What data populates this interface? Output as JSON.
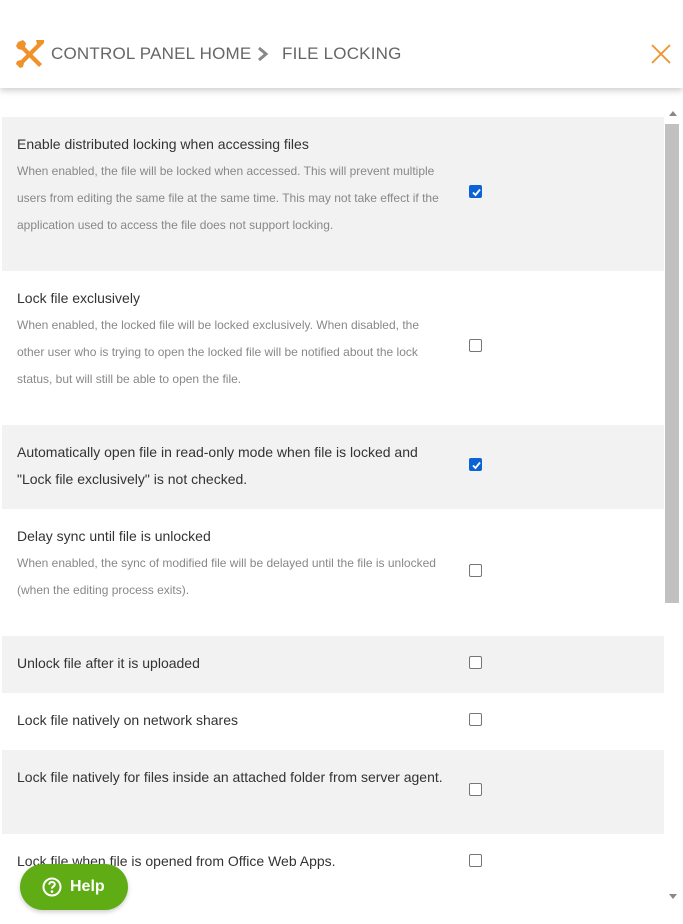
{
  "header": {
    "breadcrumb_home": "CONTROL PANEL HOME",
    "breadcrumb_current": "FILE LOCKING",
    "accent_color": "#f0922b"
  },
  "settings": [
    {
      "title": "Enable distributed locking when accessing files",
      "description": "When enabled, the file will be locked when accessed. This will prevent multiple users from editing the same file at the same time. This may not take effect if the application used to access the file does not support locking.",
      "checked": true
    },
    {
      "title": "Lock file exclusively",
      "description": "When enabled, the locked file will be locked exclusively. When disabled, the other user who is trying to open the locked file will be notified about the lock status, but will still be able to open the file.",
      "checked": false
    },
    {
      "title": "Automatically open file in read-only mode when file is locked and \"Lock file exclusively\" is not checked.",
      "description": "",
      "checked": true
    },
    {
      "title": "Delay sync until file is unlocked",
      "description": "When enabled, the sync of modified file will be delayed until the file is unlocked (when the editing process exits).",
      "checked": false
    },
    {
      "title": "Unlock file after it is uploaded",
      "description": "",
      "checked": false
    },
    {
      "title": "Lock file natively on network shares",
      "description": "",
      "checked": false
    },
    {
      "title": "Lock file natively for files inside an attached folder from server agent.",
      "description": "",
      "checked": false
    },
    {
      "title": "Lock file when file is opened from Office Web Apps.",
      "description": "",
      "checked": false
    }
  ],
  "help": {
    "label": "Help",
    "color": "#5fac15"
  }
}
